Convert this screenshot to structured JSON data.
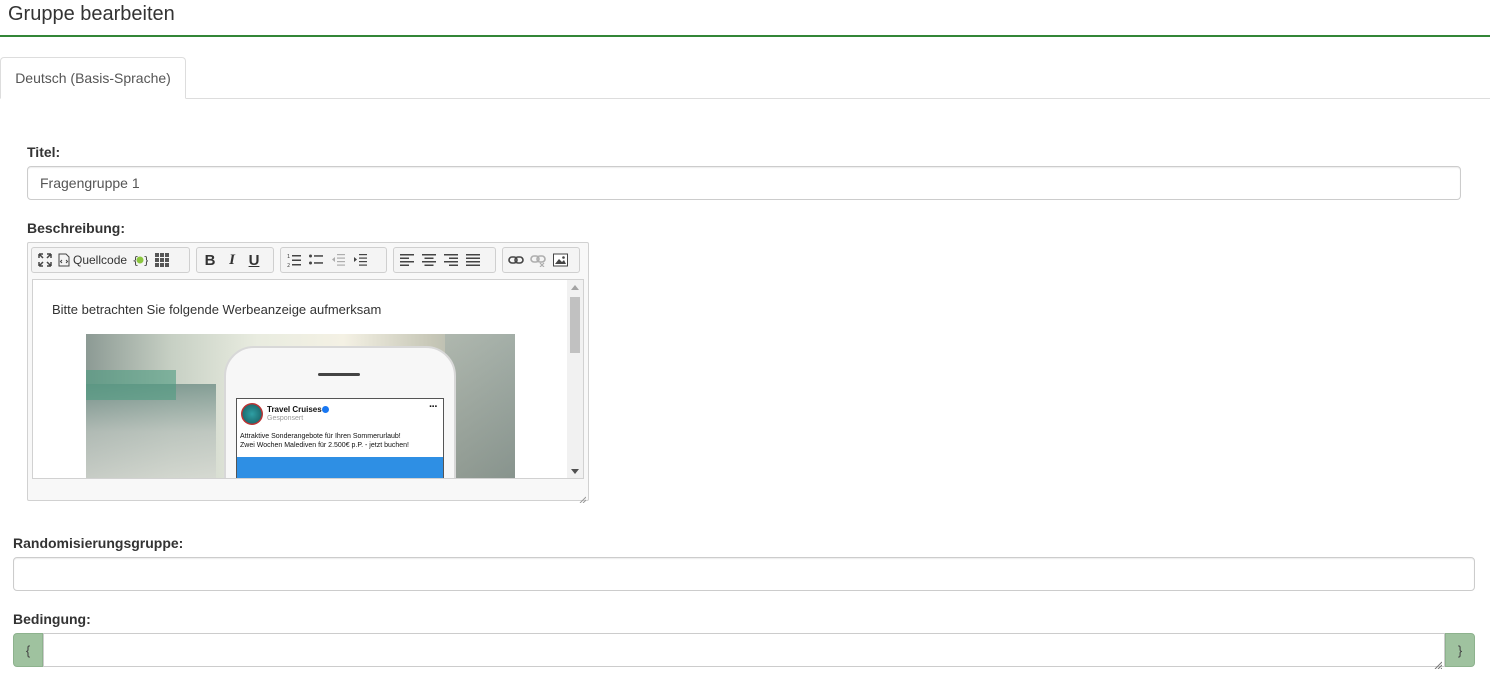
{
  "header": {
    "title": "Gruppe bearbeiten"
  },
  "tabs": [
    {
      "label": "Deutsch (Basis-Sprache)",
      "active": true
    }
  ],
  "form": {
    "title_label": "Titel:",
    "title_value": "Fragengruppe 1",
    "description_label": "Beschreibung:",
    "randomization_label": "Randomisierungsgruppe:",
    "randomization_value": "",
    "condition_label": "Bedingung:",
    "condition_value": "",
    "condition_open_brace": "{",
    "condition_close_brace": "}"
  },
  "editor": {
    "toolbar": {
      "source_label": "Quellcode",
      "bold_label": "B",
      "italic_label": "I",
      "underline_label": "U"
    },
    "content_text": "Bitte betrachten Sie folgende Werbeanzeige aufmerksam",
    "ad": {
      "page_name": "Travel Cruises",
      "sponsored": "Gesponsert",
      "dots": "···",
      "line1": "Attraktive Sonderangebote für Ihren Sommerurlaub!",
      "line2": "Zwei Wochen Malediven für 2.500€ p.P. - jetzt buchen!"
    }
  },
  "colors": {
    "accent_rule": "#328637",
    "addon_bg": "#9fc29f"
  }
}
